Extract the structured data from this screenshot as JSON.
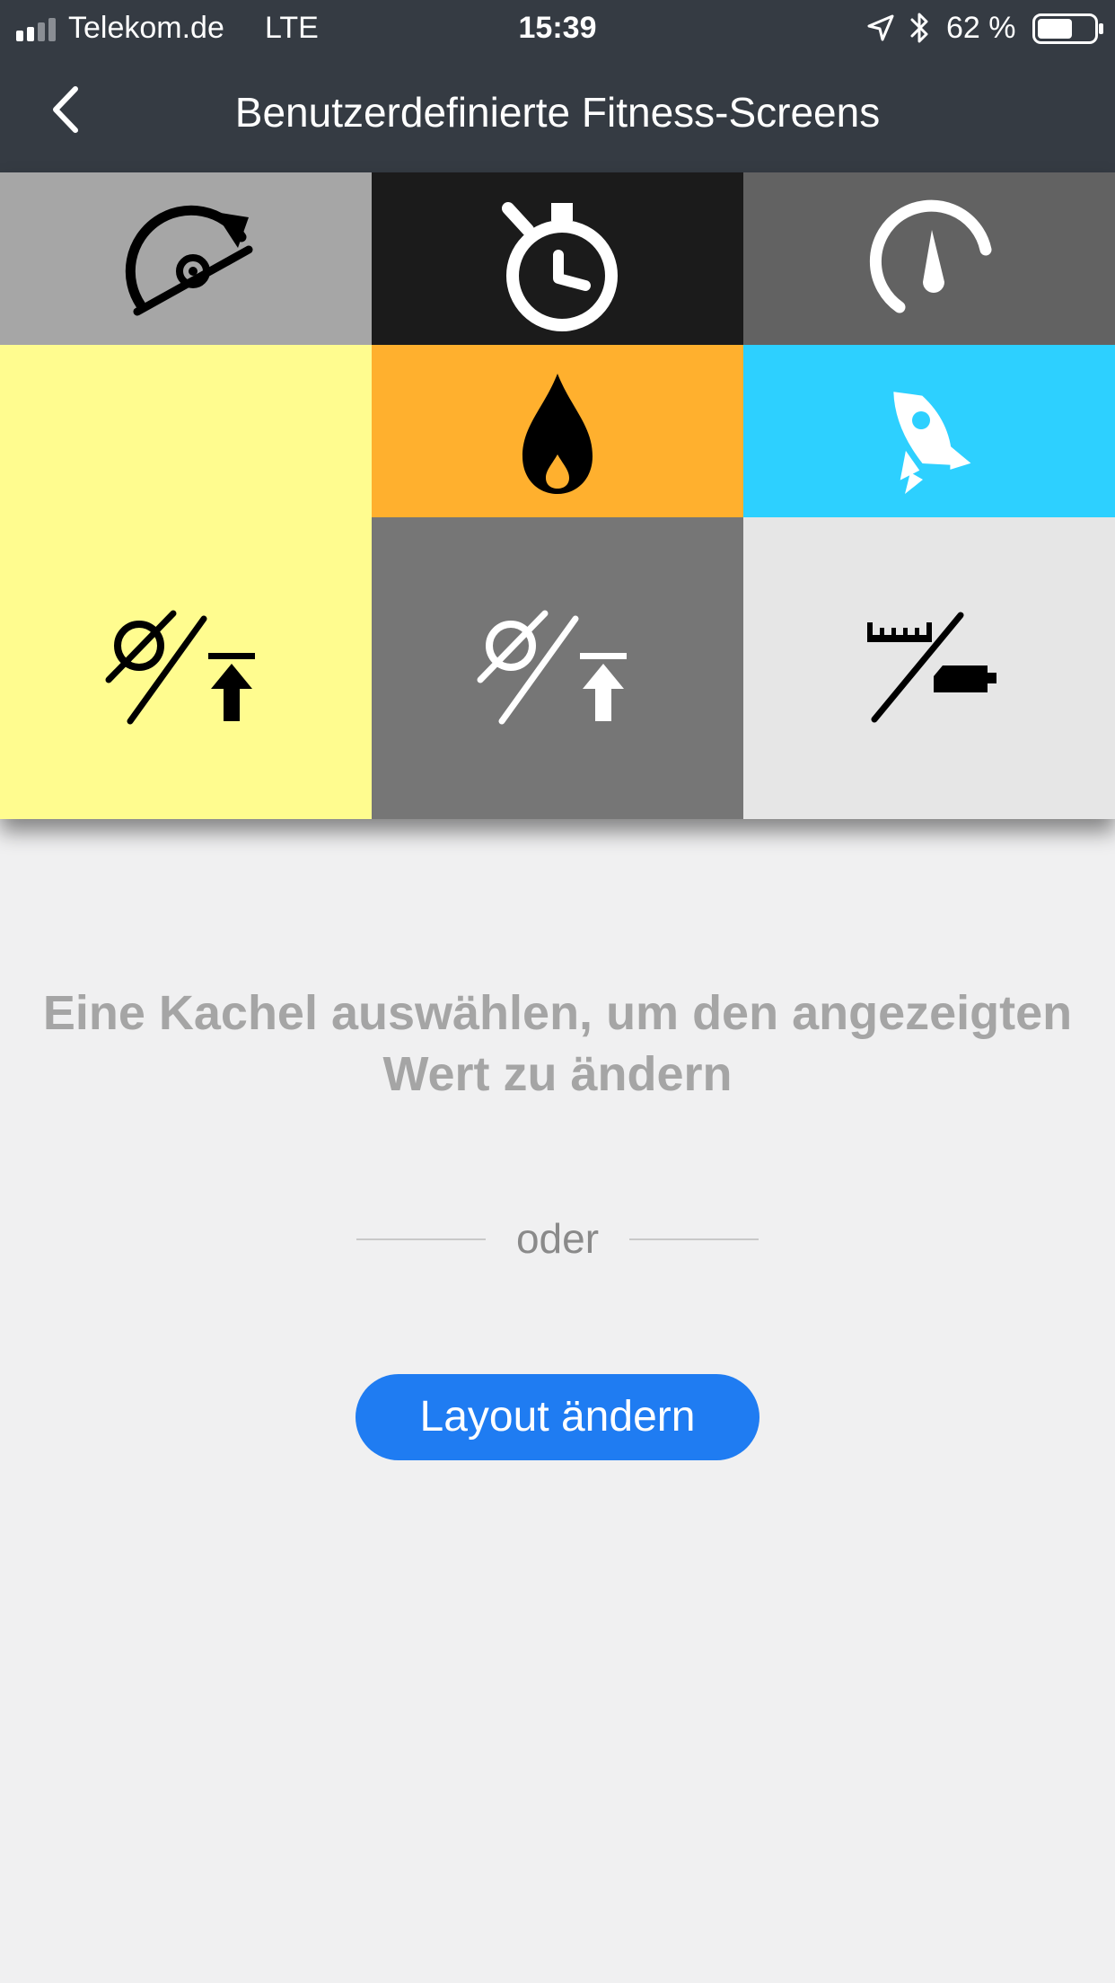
{
  "status_bar": {
    "carrier": "Telekom.de",
    "network": "LTE",
    "time": "15:39",
    "battery_percent": "62 %",
    "battery_level": 0.62,
    "signal_bars_filled": 2,
    "signal_bars_total": 4,
    "icons": [
      "signal-icon",
      "location-arrow-icon",
      "bluetooth-icon",
      "battery-icon"
    ]
  },
  "nav": {
    "title": "Benutzerdefinierte Fitness-Screens",
    "back_icon": "chevron-left-icon"
  },
  "tiles": [
    {
      "name": "tile-cadence",
      "icon": "cadence-icon",
      "color": "#a6a6a6",
      "icon_color": "#000000"
    },
    {
      "name": "tile-timer",
      "icon": "stopwatch-icon",
      "color": "#1b1b1b",
      "icon_color": "#ffffff"
    },
    {
      "name": "tile-speed",
      "icon": "speedometer-icon",
      "color": "#626262",
      "icon_color": "#ffffff"
    },
    {
      "name": "tile-pedal",
      "icon": "pedal-crank-icon",
      "color": "#fffc8f",
      "icon_color": "#000000"
    },
    {
      "name": "tile-calories",
      "icon": "flame-icon",
      "color": "#ffb02e",
      "icon_color": "#000000"
    },
    {
      "name": "tile-performance",
      "icon": "rocket-icon",
      "color": "#2dd0ff",
      "icon_color": "#ffffff"
    },
    {
      "name": "tile-avg-ascent-yellow",
      "icon": "average-ascent-icon",
      "color": "#fffc8f",
      "icon_color": "#000000"
    },
    {
      "name": "tile-avg-ascent-gray",
      "icon": "average-ascent-icon",
      "color": "#767676",
      "icon_color": "#ffffff"
    },
    {
      "name": "tile-distance-battery",
      "icon": "ruler-battery-icon",
      "color": "#e6e6e6",
      "icon_color": "#000000"
    }
  ],
  "main": {
    "hint": "Eine Kachel auswählen, um den angezeigten Wert zu ändern",
    "or_label": "oder",
    "layout_button": "Layout ändern"
  },
  "colors": {
    "header_bg": "#353b43",
    "background": "#f0f0f1",
    "button_blue": "#1f7cf2",
    "hint_text": "#a5a5a5"
  }
}
